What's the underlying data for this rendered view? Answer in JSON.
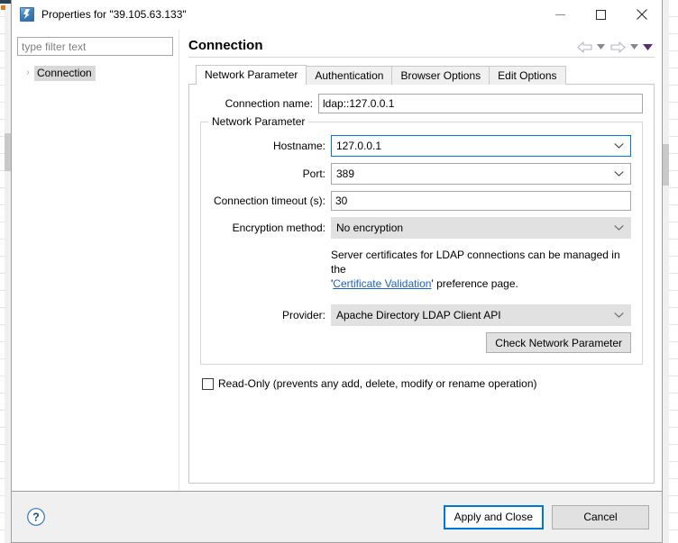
{
  "window": {
    "title": "Properties for \"39.105.63.133\"",
    "icon": "ldap-connection-icon",
    "minimize_label": "—",
    "maximize_label": "□",
    "close_label": "×"
  },
  "sidebar": {
    "filter_placeholder": "type filter text",
    "filter_value": "",
    "items": [
      {
        "label": "Connection",
        "expand_arrow": "›",
        "selected": true
      }
    ]
  },
  "page": {
    "title": "Connection",
    "nav": {
      "back": "back-arrow",
      "back_menu": "▾",
      "forward": "forward-arrow",
      "forward_menu": "▾",
      "view_menu": "▾"
    }
  },
  "tabs": [
    {
      "label": "Network Parameter",
      "active": true
    },
    {
      "label": "Authentication",
      "active": false
    },
    {
      "label": "Browser Options",
      "active": false
    },
    {
      "label": "Edit Options",
      "active": false
    }
  ],
  "form": {
    "connection_name": {
      "label": "Connection name:",
      "value": "ldap::127.0.0.1",
      "placeholder": ""
    },
    "group": {
      "title": "Network Parameter",
      "hostname": {
        "label": "Hostname:",
        "value": "127.0.0.1",
        "focused": true
      },
      "port": {
        "label": "Port:",
        "value": "389",
        "focused": false
      },
      "timeout": {
        "label": "Connection timeout (s):",
        "value": "30",
        "placeholder": ""
      },
      "encryption": {
        "label": "Encryption method:",
        "value": "No encryption",
        "readonly": true
      },
      "note": {
        "line1": "Server certificates for LDAP connections can be managed in the",
        "quote_open": "'",
        "link": "Certificate Validation",
        "quote_close": "'",
        "line2_rest": " preference page."
      },
      "provider": {
        "label": "Provider:",
        "value": "Apache Directory LDAP Client API",
        "readonly": true
      },
      "check_button": "Check Network Parameter"
    },
    "read_only": {
      "label": "Read-Only (prevents any add, delete, modify or rename operation)",
      "checked": false
    }
  },
  "footer": {
    "help": "help-icon",
    "apply_and_close": "Apply and Close",
    "cancel": "Cancel"
  },
  "colors": {
    "accent_blue": "#0078d7",
    "link_blue": "#1b62c6",
    "dialog_bg": "#f0f0f0",
    "readonly_field": "#e1e1e1",
    "nav_purple": "#5c2d6e"
  }
}
